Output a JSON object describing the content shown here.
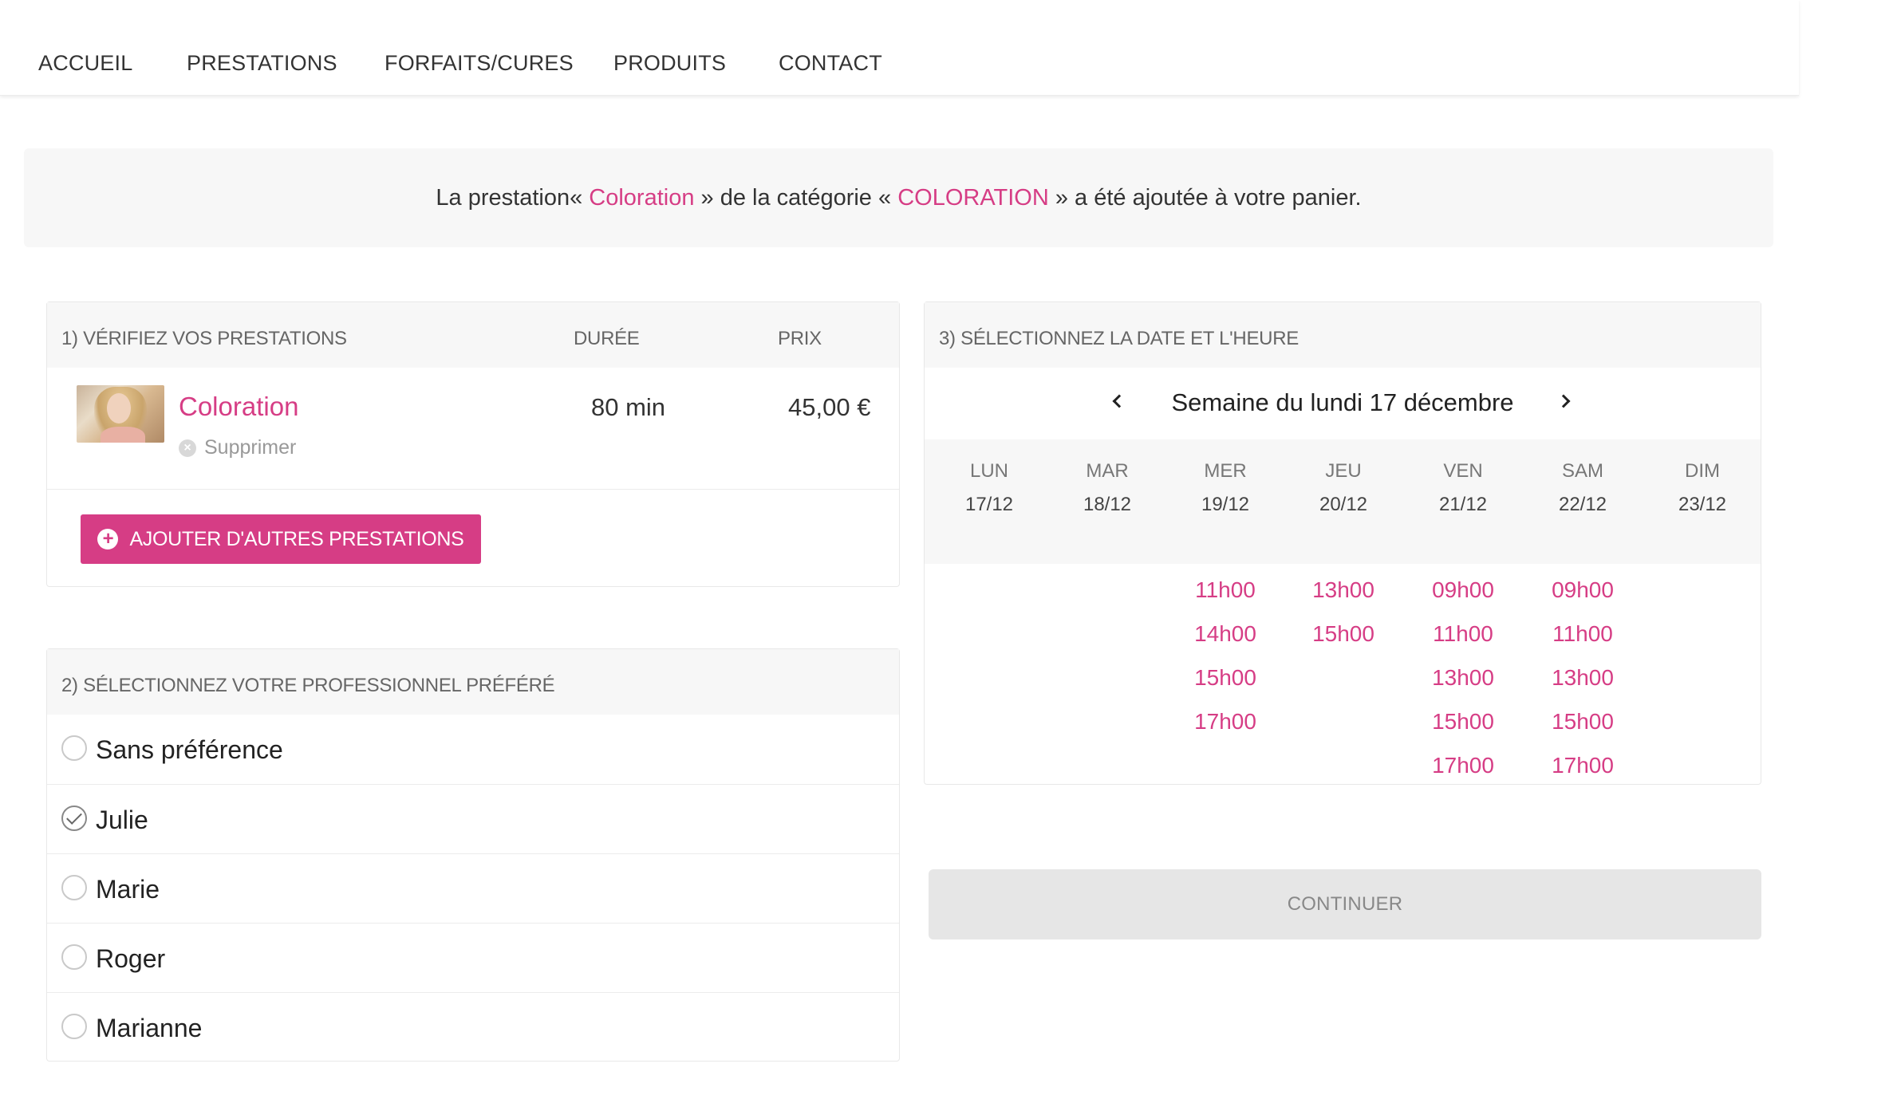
{
  "nav": {
    "items": [
      "ACCUEIL",
      "PRESTATIONS",
      "FORFAITS/CURES",
      "PRODUITS",
      "CONTACT"
    ]
  },
  "banner": {
    "prefix": "La prestation« ",
    "service": "Coloration",
    "middle": " » de la catégorie « ",
    "category": "COLORATION",
    "suffix": " » a été ajoutée à votre panier."
  },
  "services_panel": {
    "title": "1) VÉRIFIEZ VOS PRESTATIONS",
    "col_duration": "DURÉE",
    "col_price": "PRIX",
    "item": {
      "name": "Coloration",
      "remove_label": "Supprimer",
      "duration": "80 min",
      "price": "45,00 €"
    },
    "add_button": "AJOUTER D'AUTRES PRESTATIONS"
  },
  "pro_panel": {
    "title": "2) SÉLECTIONNEZ VOTRE PROFESSIONNEL PRÉFÉRÉ",
    "options": [
      {
        "name": "Sans préférence",
        "selected": false
      },
      {
        "name": "Julie",
        "selected": true
      },
      {
        "name": "Marie",
        "selected": false
      },
      {
        "name": "Roger",
        "selected": false
      },
      {
        "name": "Marianne",
        "selected": false
      }
    ]
  },
  "date_panel": {
    "title": "3) SÉLECTIONNEZ LA DATE ET L'HEURE",
    "week_label": "Semaine du lundi 17 décembre",
    "days": [
      {
        "name": "LUN",
        "date": "17/12",
        "slots": []
      },
      {
        "name": "MAR",
        "date": "18/12",
        "slots": []
      },
      {
        "name": "MER",
        "date": "19/12",
        "slots": [
          "11h00",
          "14h00",
          "15h00",
          "17h00"
        ]
      },
      {
        "name": "JEU",
        "date": "20/12",
        "slots": [
          "13h00",
          "15h00"
        ]
      },
      {
        "name": "VEN",
        "date": "21/12",
        "slots": [
          "09h00",
          "11h00",
          "13h00",
          "15h00",
          "17h00"
        ]
      },
      {
        "name": "SAM",
        "date": "22/12",
        "slots": [
          "09h00",
          "11h00",
          "13h00",
          "15h00",
          "17h00"
        ]
      },
      {
        "name": "DIM",
        "date": "23/12",
        "slots": []
      }
    ]
  },
  "continue_button": "CONTINUER",
  "colors": {
    "accent": "#d63d85",
    "panel_head": "#f7f7f7",
    "button_disabled": "#e6e6e6"
  }
}
